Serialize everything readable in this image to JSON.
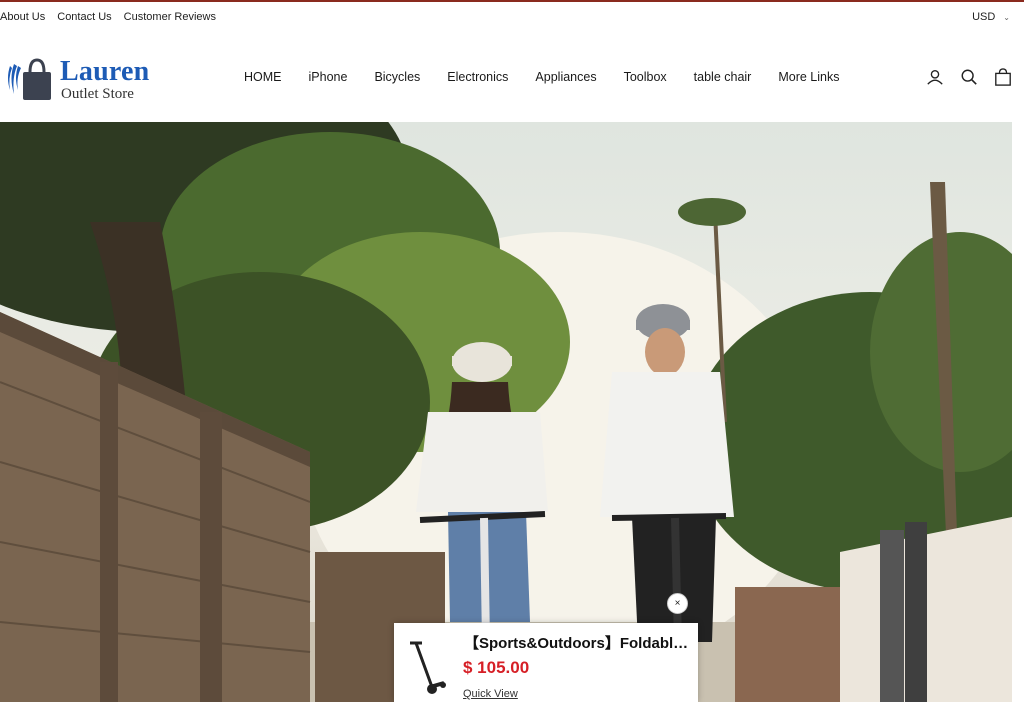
{
  "topbar": {
    "links": [
      "About Us",
      "Contact Us",
      "Customer Reviews"
    ],
    "currency": "USD"
  },
  "logo": {
    "brand": "Lauren",
    "sub": "Outlet Store"
  },
  "nav": {
    "items": [
      "HOME",
      "iPhone",
      "Bicycles",
      "Electronics",
      "Appliances",
      "Toolbox",
      "table chair",
      "More Links"
    ]
  },
  "icons": {
    "account": "account-icon",
    "search": "search-icon",
    "cart": "cart-icon"
  },
  "popup": {
    "title": "【Sports&Outdoors】Foldable Electric Scooter",
    "price": "$ 105.00",
    "quick_view": "Quick View",
    "close": "×"
  },
  "colors": {
    "brand_blue": "#1d5bb5",
    "price_red": "#d61f26",
    "accent_top": "#8a2a1e"
  }
}
